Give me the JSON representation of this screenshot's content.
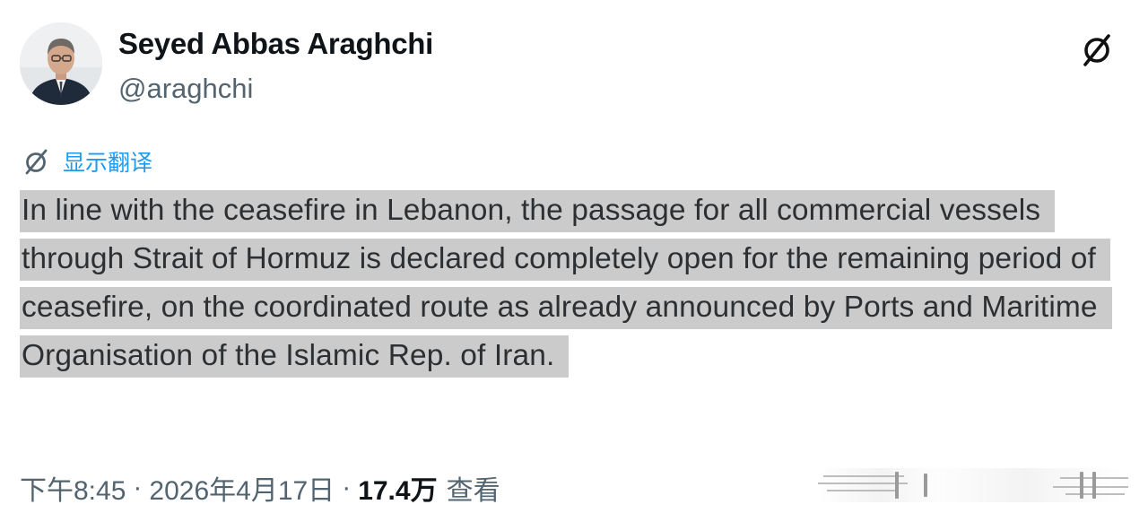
{
  "tweet": {
    "author": {
      "display_name": "Seyed Abbas Araghchi",
      "handle": "@araghchi",
      "avatar_icon": "person-avatar"
    },
    "brand_icon": "x-logo-icon",
    "translate": {
      "icon": "translate-logo-icon",
      "label": "显示翻译"
    },
    "text": "In line with the ceasefire in Lebanon, the passage for all commercial vessels through Strait of Hormuz is declared completely open for the remaining period of ceasefire, on the coordinated route as already announced by Ports and Maritime Organisation of the Islamic Rep. of Iran.",
    "meta": {
      "time": "下午8:45",
      "separator": "·",
      "date": "2026年4月17日",
      "views_count": "17.4万",
      "views_label": "查看"
    }
  },
  "colors": {
    "text_primary": "#0f1419",
    "text_secondary": "#536471",
    "link_blue": "#1d9bf0",
    "highlight_gray": "#cbcbcb"
  }
}
